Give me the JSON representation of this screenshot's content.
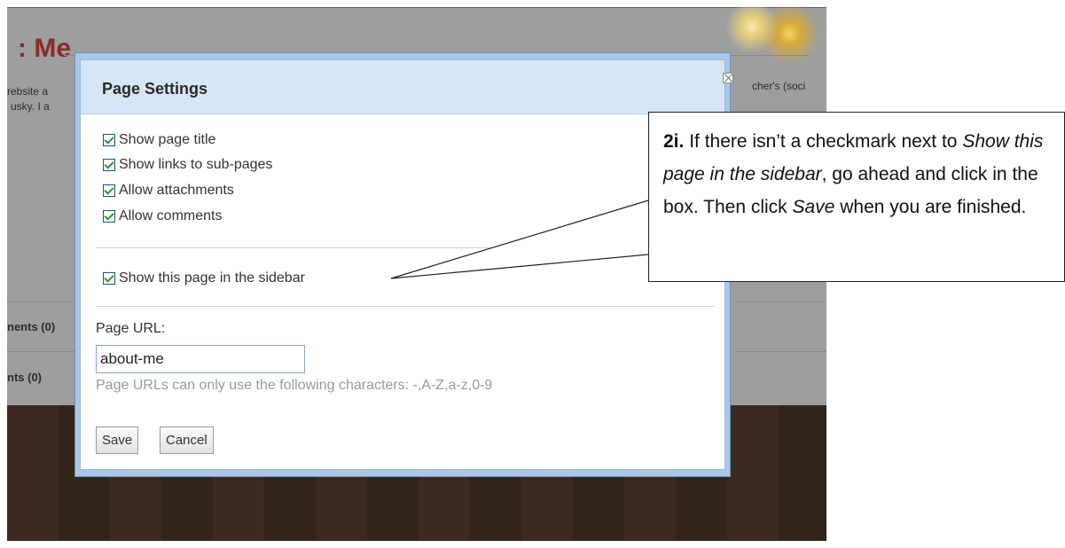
{
  "background_page": {
    "title_fragment": ": Me",
    "text_lines": [
      "rebsite a",
      "usky. I a"
    ],
    "right_text": "cher's (soci",
    "links": [
      "nents (0)",
      "nts (0)"
    ]
  },
  "dialog": {
    "title": "Page Settings",
    "close_label": "×",
    "options": [
      {
        "label": "Show page title",
        "checked": true
      },
      {
        "label": "Show links to sub-pages",
        "checked": true
      },
      {
        "label": "Allow attachments",
        "checked": true
      },
      {
        "label": "Allow comments",
        "checked": true
      }
    ],
    "sidebar_option": {
      "label": "Show this page in the sidebar",
      "checked": true
    },
    "url_label": "Page URL:",
    "url_value": "about-me",
    "url_hint": "Page URLs can only use the following characters: -,A-Z,a-z,0-9",
    "save_label": "Save",
    "cancel_label": "Cancel"
  },
  "callout": {
    "step": "2i.",
    "text_1": " If there isn’t a checkmark next to ",
    "italic_1": "Show this page in the sidebar",
    "text_2": ", go ahead and click in the box. Then click ",
    "italic_2": "Save",
    "text_3": " when you are finished."
  },
  "colors": {
    "page_title": "#8b2a2a",
    "dialog_header": "#d7e6f7",
    "checkmark": "#21a121"
  }
}
